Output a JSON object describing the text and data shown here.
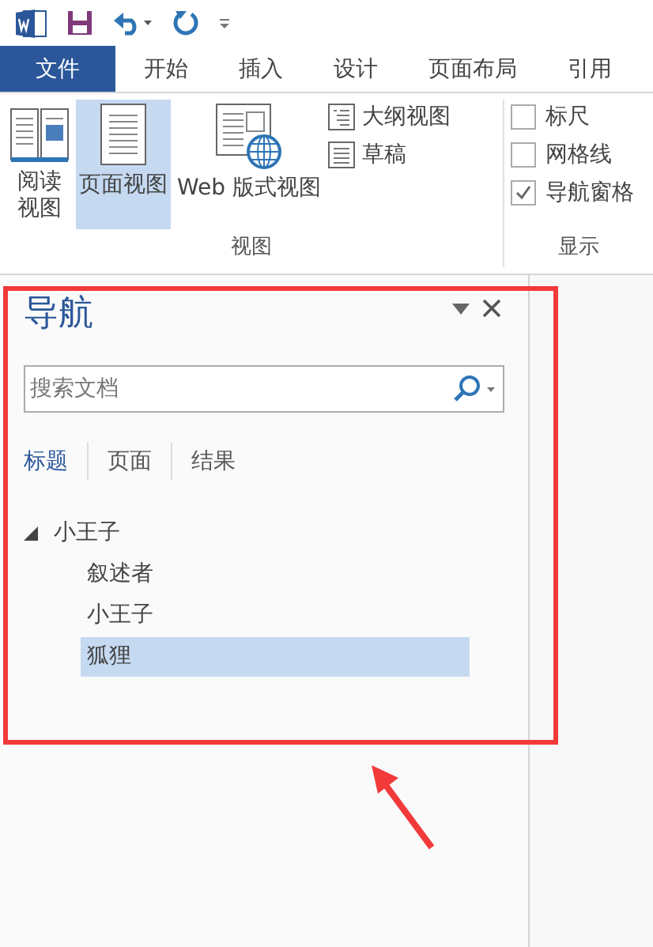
{
  "tabs": [
    {
      "label": "文件",
      "kind": "file"
    },
    {
      "label": "开始",
      "kind": "tab"
    },
    {
      "label": "插入",
      "kind": "tab"
    },
    {
      "label": "设计",
      "kind": "tab"
    },
    {
      "label": "页面布局",
      "kind": "tab"
    },
    {
      "label": "引用",
      "kind": "tab"
    }
  ],
  "ribbon": {
    "view_group": {
      "label": "视图",
      "large_buttons": [
        {
          "label_lines": [
            "阅读",
            "视图"
          ],
          "selected": false
        },
        {
          "label_lines": [
            "页面视图"
          ],
          "selected": true
        },
        {
          "label_lines": [
            "Web 版式视图"
          ],
          "selected": false
        }
      ],
      "small_buttons": [
        {
          "label": "大纲视图"
        },
        {
          "label": "草稿"
        }
      ]
    },
    "show_group": {
      "label": "显示",
      "checkboxes": [
        {
          "label": "标尺",
          "checked": false
        },
        {
          "label": "网格线",
          "checked": false
        },
        {
          "label": "导航窗格",
          "checked": true
        }
      ]
    }
  },
  "navigation": {
    "title": "导航",
    "search": {
      "placeholder": "搜索文档"
    },
    "tabs": [
      {
        "label": "标题",
        "selected": true
      },
      {
        "label": "页面",
        "selected": false
      },
      {
        "label": "结果",
        "selected": false
      }
    ],
    "tree": [
      {
        "label": "小王子",
        "expanded": true,
        "selected": false,
        "children": [
          {
            "label": "叙述者",
            "selected": false
          },
          {
            "label": "小王子",
            "selected": false
          },
          {
            "label": "狐狸",
            "selected": true
          }
        ]
      }
    ]
  }
}
